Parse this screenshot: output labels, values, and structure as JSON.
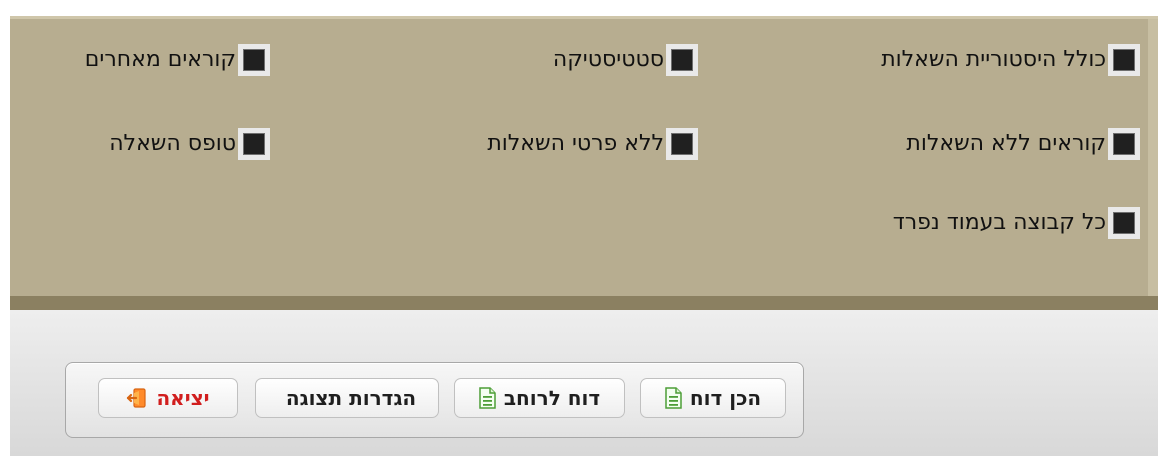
{
  "options": {
    "include_question_history": "כולל היסטוריית השאלות",
    "statistics": "סטטיסטיקה",
    "other_readers": "קוראים מאחרים",
    "readers_without_questions": "קוראים ללא השאלות",
    "without_question_details": "ללא פרטי השאלות",
    "question_form": "טופס השאלה",
    "each_group_separate_page": "כל קבוצה בעמוד נפרד"
  },
  "toolbar": {
    "prepare_report": "הכן דוח",
    "wide_report": "דוח לרוחב",
    "display_settings": "הגדרות תצוגה",
    "exit": "יציאה"
  },
  "colors": {
    "options_panel": "#b7ad90",
    "exit_text": "#d11e1e"
  },
  "icons": {
    "checkbox": "checkbox-icon",
    "report": "document-icon",
    "exit": "exit-icon"
  }
}
